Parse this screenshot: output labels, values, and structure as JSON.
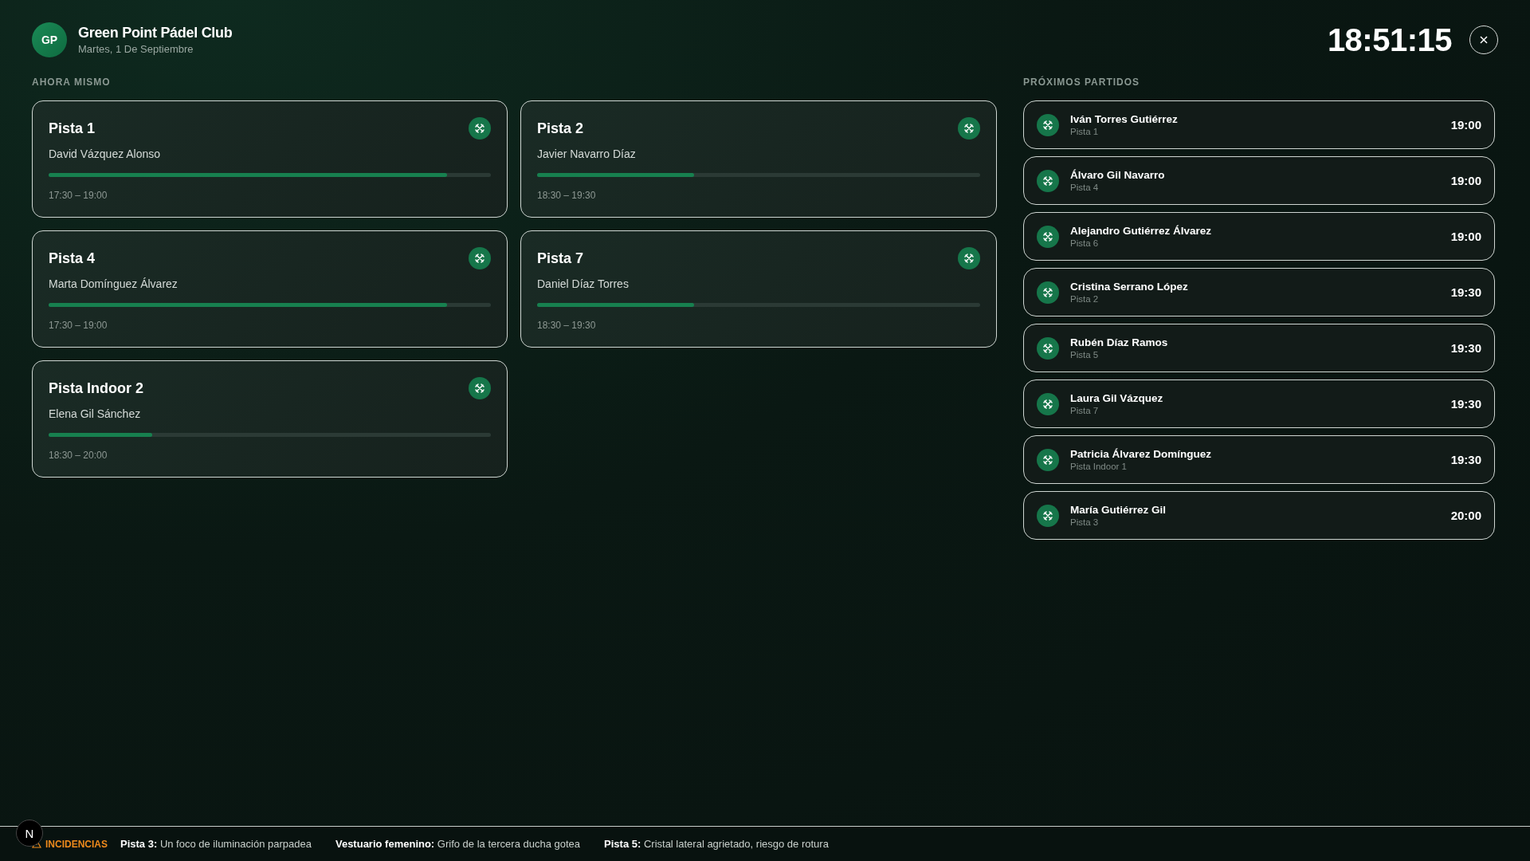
{
  "header": {
    "logo": "GP",
    "club": "Green Point Pádel Club",
    "date": "Martes, 1 De Septiembre",
    "clock": "18:51:15"
  },
  "now": {
    "title": "AHORA MISMO",
    "courts": [
      {
        "court": "Pista 1",
        "player": "David Vázquez Alonso",
        "level": 0.9,
        "time": "17:30 – 19:00"
      },
      {
        "court": "Pista 2",
        "player": "Javier Navarro Díaz",
        "level": 0.355,
        "time": "18:30 – 19:30"
      },
      {
        "court": "Pista 4",
        "player": "Marta Domínguez Álvarez",
        "level": 0.9,
        "time": "17:30 – 19:00"
      },
      {
        "court": "Pista 7",
        "player": "Daniel Díaz Torres",
        "level": 0.355,
        "time": "18:30 – 19:30"
      },
      {
        "court": "Pista Indoor 2",
        "player": "Elena Gil Sánchez",
        "level": 0.235,
        "time": "18:30 – 20:00"
      }
    ]
  },
  "upcoming": {
    "title": "PRÓXIMOS PARTIDOS",
    "matches": [
      {
        "player": "Iván Torres Gutiérrez",
        "court": "Pista 1",
        "time": "19:00"
      },
      {
        "player": "Álvaro Gil Navarro",
        "court": "Pista 4",
        "time": "19:00"
      },
      {
        "player": "Alejandro Gutiérrez Álvarez",
        "court": "Pista 6",
        "time": "19:00"
      },
      {
        "player": "Cristina Serrano López",
        "court": "Pista 2",
        "time": "19:30"
      },
      {
        "player": "Rubén Díaz Ramos",
        "court": "Pista 5",
        "time": "19:30"
      },
      {
        "player": "Laura Gil Vázquez",
        "court": "Pista 7",
        "time": "19:30"
      },
      {
        "player": "Patricia Álvarez Domínguez",
        "court": "Pista Indoor 1",
        "time": "19:30"
      },
      {
        "player": "María Gutiérrez Gil",
        "court": "Pista 3",
        "time": "20:00"
      }
    ]
  },
  "incidents": {
    "title": "INCIDENCIAS",
    "items": [
      {
        "place": "Pista 3:",
        "text": "Un foco de iluminación parpadea"
      },
      {
        "place": "Vestuario femenino:",
        "text": "Grifo de la tercera ducha gotea"
      },
      {
        "place": "Pista 5:",
        "text": "Cristal lateral agrietado, riesgo de rotura"
      }
    ]
  },
  "dev_badge": "N"
}
